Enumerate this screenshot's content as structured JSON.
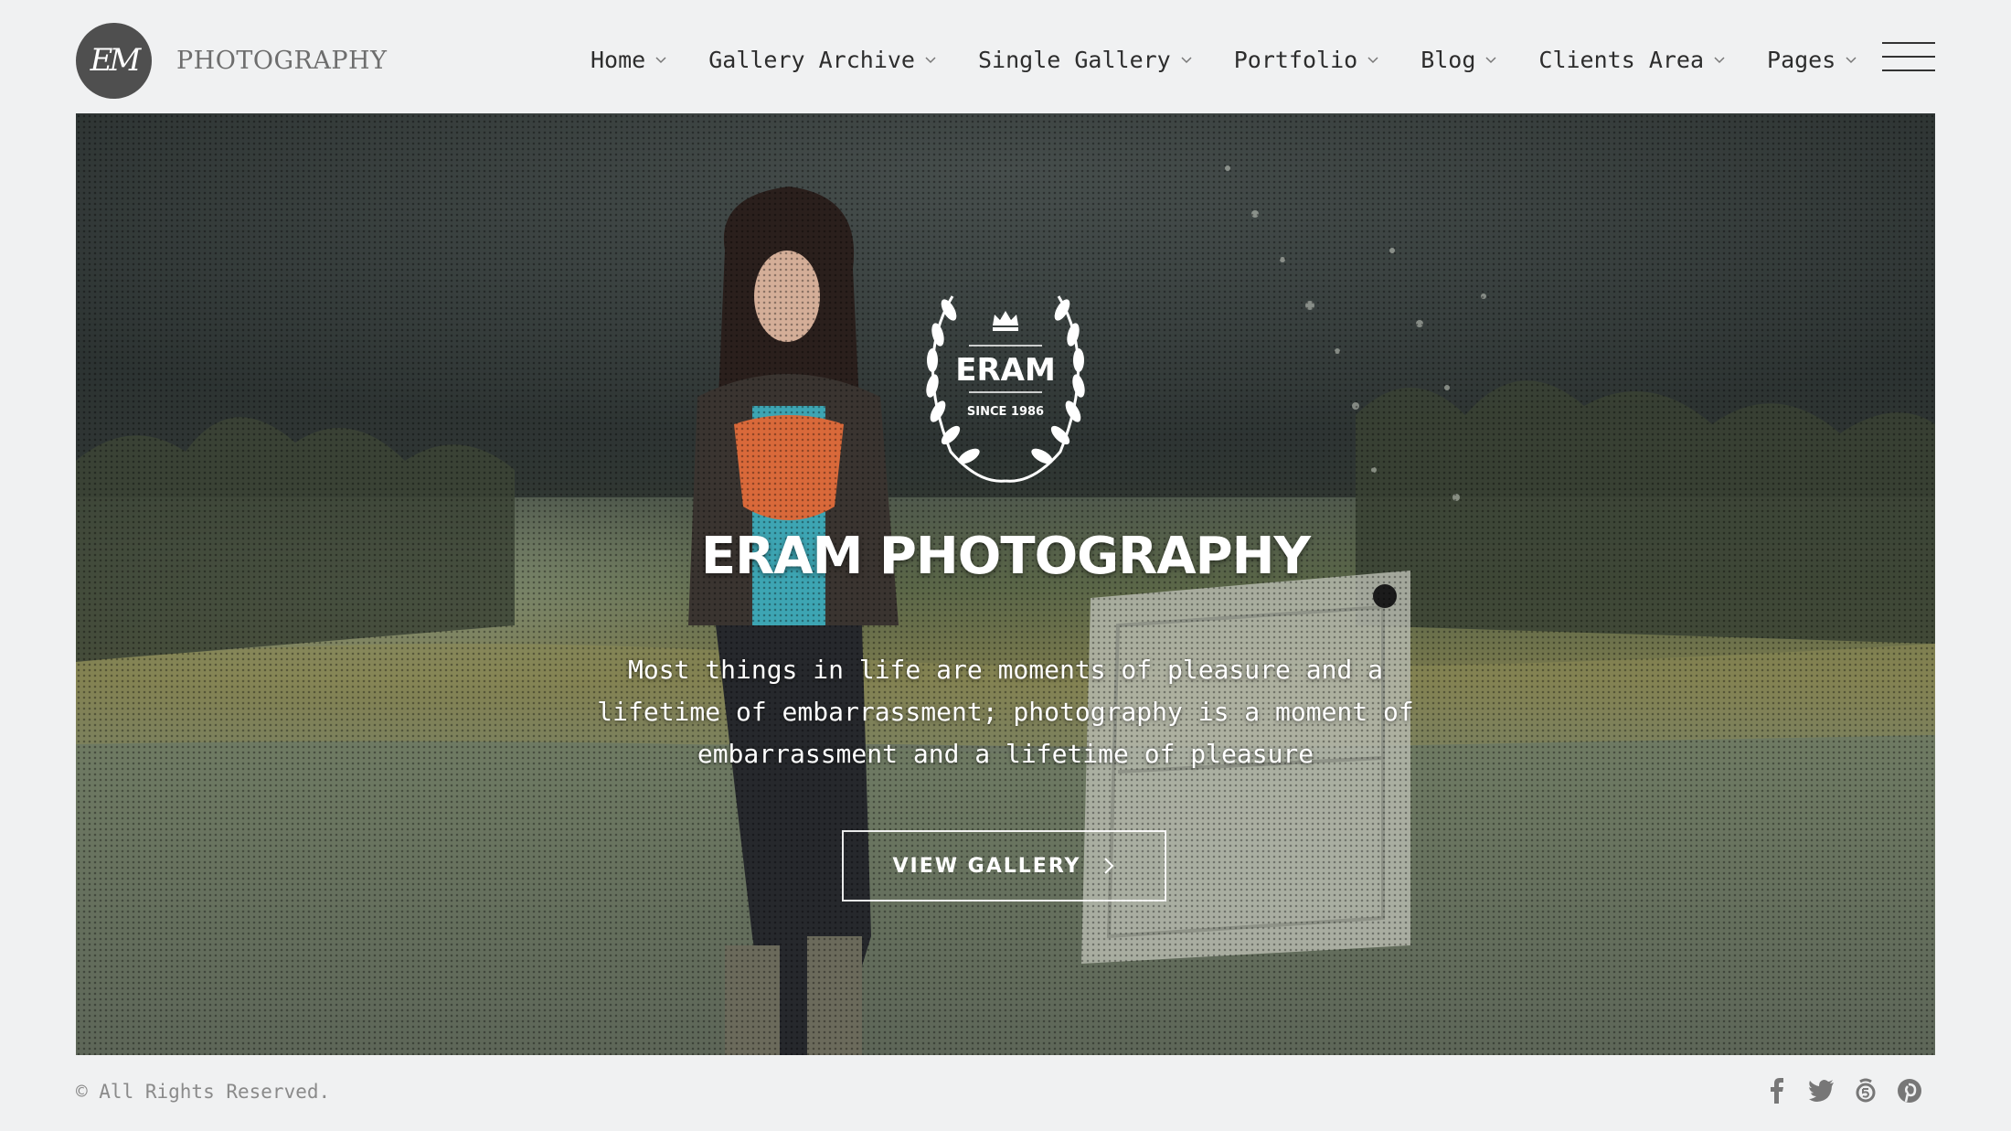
{
  "brand": {
    "monogram": "EM",
    "name": "PHOTOGRAPHY"
  },
  "nav": {
    "items": [
      {
        "label": "Home"
      },
      {
        "label": "Gallery Archive"
      },
      {
        "label": "Single Gallery"
      },
      {
        "label": "Portfolio"
      },
      {
        "label": "Blog"
      },
      {
        "label": "Clients Area"
      },
      {
        "label": "Pages"
      }
    ],
    "menu_icon": "hamburger-icon"
  },
  "hero": {
    "emblem": {
      "name": "ERAM",
      "since": "SINCE 1986",
      "icon": "crown-icon"
    },
    "title": "ERAM PHOTOGRAPHY",
    "quote_lines": [
      "Most things in life are moments of pleasure and a",
      "lifetime of embarrassment; photography is a moment of",
      "embarrassment and a lifetime of pleasure"
    ],
    "cta_label": "VIEW GALLERY"
  },
  "footer": {
    "copyright": "© All Rights Reserved.",
    "social": [
      "facebook-icon",
      "twitter-icon",
      "500px-icon",
      "pinterest-icon"
    ]
  },
  "colors": {
    "background": "#f0f1f2",
    "text": "#2d2d2d",
    "logo_circle": "#4f4f4f",
    "muted": "#8a8a8a"
  }
}
